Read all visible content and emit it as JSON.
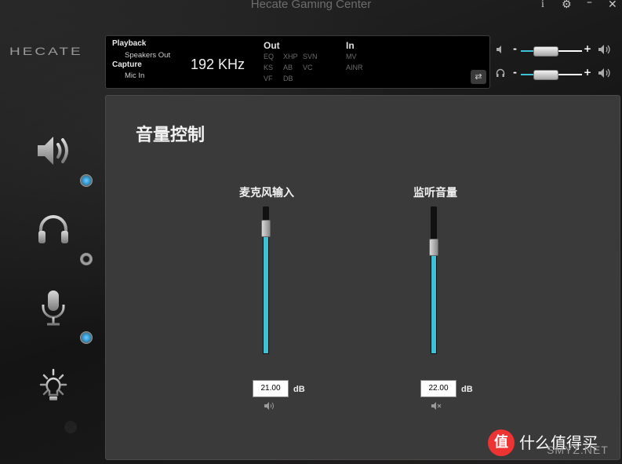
{
  "window": {
    "title": "Hecate Gaming Center",
    "buttons": {
      "info": "i",
      "settings": "⚙",
      "minimize": "–",
      "close": "✕"
    }
  },
  "logo": "HECATE",
  "info_panel": {
    "playback_label": "Playback",
    "playback_device": "Speakers Out",
    "capture_label": "Capture",
    "capture_device": "Mic In",
    "sample_rate": "192  KHz",
    "out_label": "Out",
    "out_tags": [
      "EQ",
      "XHP",
      "SVN",
      "KS",
      "AB",
      "VC",
      "VF",
      "DB"
    ],
    "in_label": "In",
    "in_tags": [
      "MV",
      "AINR"
    ],
    "swap_icon": "⇄"
  },
  "quick_sliders": [
    {
      "name": "speaker",
      "icon": "speaker-icon",
      "level": 0.4
    },
    {
      "name": "headphone",
      "icon": "headphone-icon",
      "level": 0.4
    }
  ],
  "nav": [
    {
      "icon": "speaker-icon",
      "active": true
    },
    {
      "icon": "headphone-icon",
      "active": false
    },
    {
      "icon": "microphone-icon",
      "active": true
    },
    {
      "icon": "light-icon",
      "active": false
    }
  ],
  "main": {
    "title": "音量控制",
    "channels": [
      {
        "label": "麦克风输入",
        "level": 0.88,
        "value": "21.00",
        "unit": "dB",
        "status_icon": "speaker-on-icon"
      },
      {
        "label": "监听音量",
        "level": 0.75,
        "value": "22.00",
        "unit": "dB",
        "status_icon": "speaker-muted-icon"
      }
    ]
  },
  "watermark": {
    "badge": "值",
    "text": "什么值得买",
    "site": "SMYZ.NET"
  },
  "colors": {
    "accent": "#3ec1d3",
    "panel": "#3a3a3a",
    "background": "#1b1b1b"
  }
}
